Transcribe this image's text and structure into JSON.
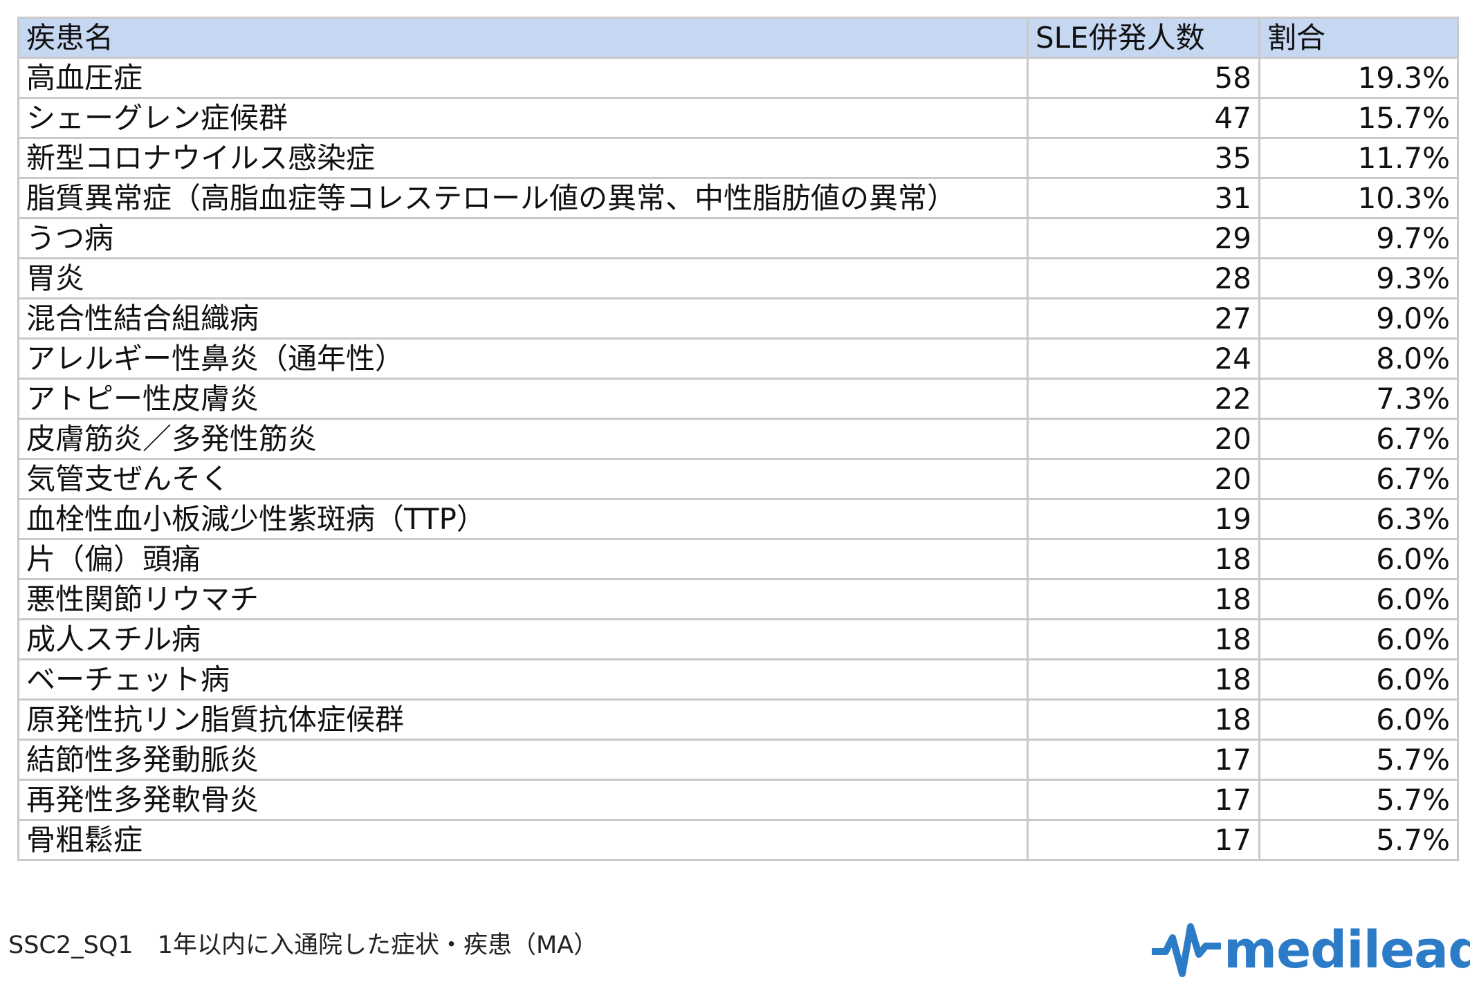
{
  "table": {
    "headers": {
      "name": "疾患名",
      "count": "SLE併発人数",
      "ratio": "割合"
    },
    "rows": [
      {
        "name": "高血圧症",
        "count": "58",
        "ratio": "19.3%"
      },
      {
        "name": "シェーグレン症候群",
        "count": "47",
        "ratio": "15.7%"
      },
      {
        "name": "新型コロナウイルス感染症",
        "count": "35",
        "ratio": "11.7%"
      },
      {
        "name": "脂質異常症（高脂血症等コレステロール値の異常、中性脂肪値の異常）",
        "count": "31",
        "ratio": "10.3%"
      },
      {
        "name": "うつ病",
        "count": "29",
        "ratio": "9.7%"
      },
      {
        "name": "胃炎",
        "count": "28",
        "ratio": "9.3%"
      },
      {
        "name": "混合性結合組織病",
        "count": "27",
        "ratio": "9.0%"
      },
      {
        "name": "アレルギー性鼻炎（通年性）",
        "count": "24",
        "ratio": "8.0%"
      },
      {
        "name": "アトピー性皮膚炎",
        "count": "22",
        "ratio": "7.3%"
      },
      {
        "name": "皮膚筋炎／多発性筋炎",
        "count": "20",
        "ratio": "6.7%"
      },
      {
        "name": "気管支ぜんそく",
        "count": "20",
        "ratio": "6.7%"
      },
      {
        "name": "血栓性血小板減少性紫斑病（TTP）",
        "count": "19",
        "ratio": "6.3%"
      },
      {
        "name": "片（偏）頭痛",
        "count": "18",
        "ratio": "6.0%"
      },
      {
        "name": "悪性関節リウマチ",
        "count": "18",
        "ratio": "6.0%"
      },
      {
        "name": "成人スチル病",
        "count": "18",
        "ratio": "6.0%"
      },
      {
        "name": "ベーチェット病",
        "count": "18",
        "ratio": "6.0%"
      },
      {
        "name": "原発性抗リン脂質抗体症候群",
        "count": "18",
        "ratio": "6.0%"
      },
      {
        "name": "結節性多発動脈炎",
        "count": "17",
        "ratio": "5.7%"
      },
      {
        "name": "再発性多発軟骨炎",
        "count": "17",
        "ratio": "5.7%"
      },
      {
        "name": "骨粗鬆症",
        "count": "17",
        "ratio": "5.7%"
      }
    ]
  },
  "footer": {
    "caption": "SSC2_SQ1　1年以内に入通院した症状・疾患（MA）",
    "logo_text": "medilead"
  },
  "colors": {
    "header_bg": "#c6d7f2",
    "grid": "#c9c9c9",
    "logo": "#2b7bc7"
  },
  "icons": {
    "logo_mark": "pulse-wave-icon"
  }
}
